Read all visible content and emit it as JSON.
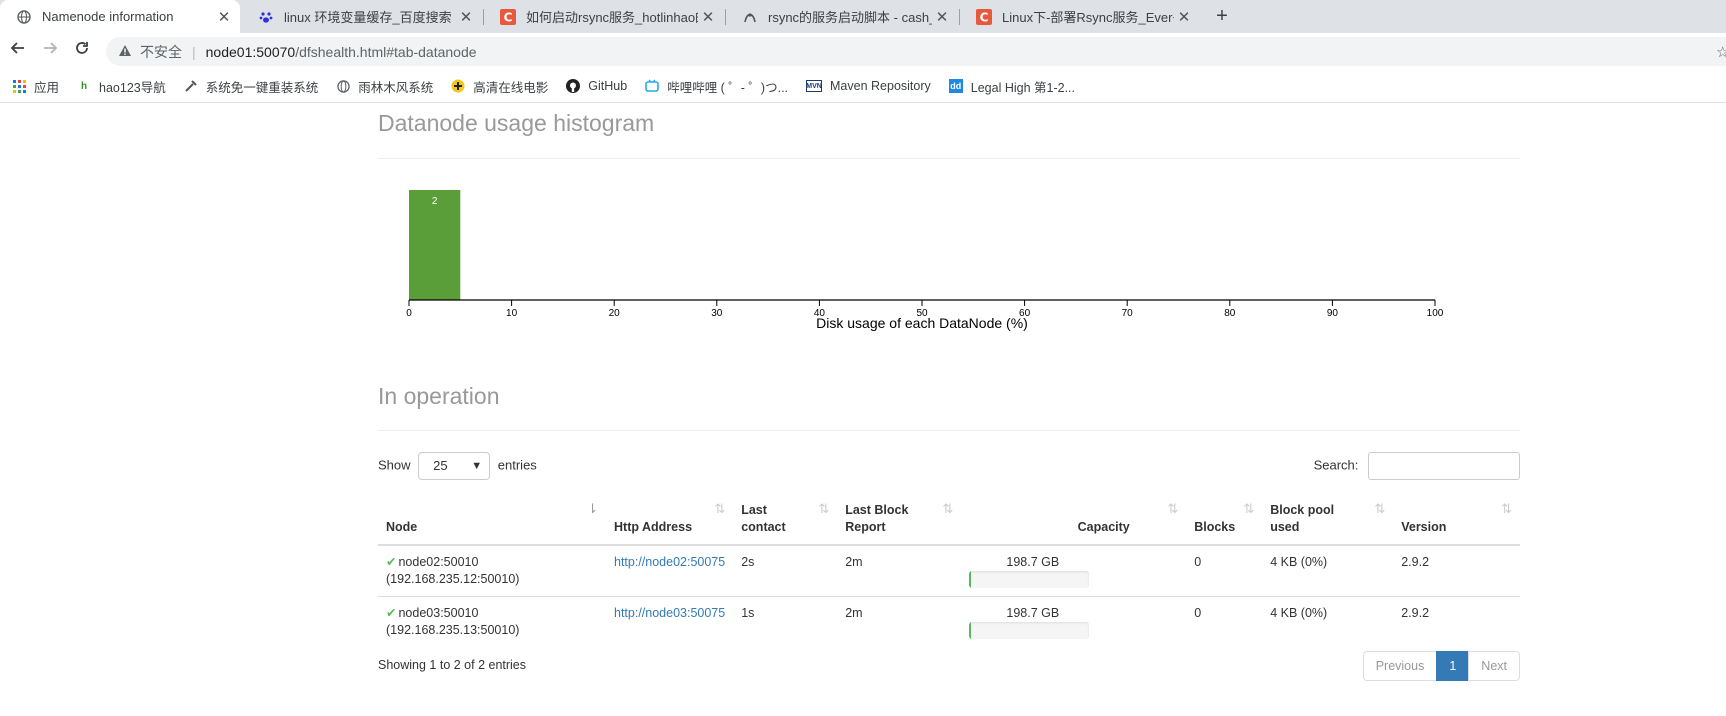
{
  "browser": {
    "tabs": [
      {
        "title": "Namenode information",
        "icon": "globe-icon"
      },
      {
        "title": "linux 环境变量缓存_百度搜索",
        "icon": "baidu-paw-icon"
      },
      {
        "title": "如何启动rsync服务_hotlinhao的",
        "icon": "csdn-icon"
      },
      {
        "title": "rsync的服务启动脚本 - cash_su",
        "icon": "cnblogs-icon"
      },
      {
        "title": "Linux下-部署Rsync服务_Ever~z",
        "icon": "csdn-icon"
      }
    ],
    "close_glyph": "✕",
    "newtab_glyph": "+",
    "insecure_label": "不安全",
    "url_host": "node01:50070",
    "url_path": "/dfshealth.html#tab-datanode",
    "bookmarks": [
      {
        "label": "应用",
        "icon": "apps-grid-icon"
      },
      {
        "label": "hao123导航",
        "icon": "hao123-icon"
      },
      {
        "label": "系统免一键重装系统",
        "icon": "tool-icon"
      },
      {
        "label": "雨林木风系统",
        "icon": "globe-icon"
      },
      {
        "label": "高清在线电影",
        "icon": "movie-icon"
      },
      {
        "label": "GitHub",
        "icon": "github-icon"
      },
      {
        "label": "哔哩哔哩 ( ゜- ゜)つ...",
        "icon": "bilibili-icon"
      },
      {
        "label": "Maven Repository",
        "icon": "maven-icon"
      },
      {
        "label": "Legal High 第1-2...",
        "icon": "dd-icon"
      }
    ]
  },
  "histogram_section": {
    "title": "Datanode usage histogram"
  },
  "chart_data": {
    "type": "bar",
    "title": "",
    "xlabel": "Disk usage of each DataNode (%)",
    "ylabel": "",
    "xlim": [
      0,
      100
    ],
    "xticks": [
      0,
      10,
      20,
      30,
      40,
      50,
      60,
      70,
      80,
      90,
      100
    ],
    "bins": [
      {
        "x0": 0,
        "x1": 5,
        "count": 2
      }
    ],
    "bar_color": "#5a9e3a",
    "grid": false
  },
  "operation_section": {
    "title": "In operation",
    "show_label": "Show",
    "entries_value": "25",
    "entries_label": "entries",
    "search_label": "Search:",
    "columns": [
      "Node",
      "Http Address",
      "Last contact",
      "Last Block Report",
      "Capacity",
      "Blocks",
      "Block pool used",
      "Version"
    ],
    "rows": [
      {
        "node": "node02:50010",
        "ip": "(192.168.235.12:50010)",
        "http": "http://node02:50075",
        "last_contact": "2s",
        "last_block": "2m",
        "capacity": "198.7 GB",
        "used_fraction": 0.01,
        "blocks": "0",
        "pool_used": "4 KB (0%)",
        "version": "2.9.2"
      },
      {
        "node": "node03:50010",
        "ip": "(192.168.235.13:50010)",
        "http": "http://node03:50075",
        "last_contact": "1s",
        "last_block": "2m",
        "capacity": "198.7 GB",
        "used_fraction": 0.01,
        "blocks": "0",
        "pool_used": "4 KB (0%)",
        "version": "2.9.2"
      }
    ],
    "info": "Showing 1 to 2 of 2 entries",
    "pager": {
      "previous": "Previous",
      "current": "1",
      "next": "Next"
    }
  }
}
